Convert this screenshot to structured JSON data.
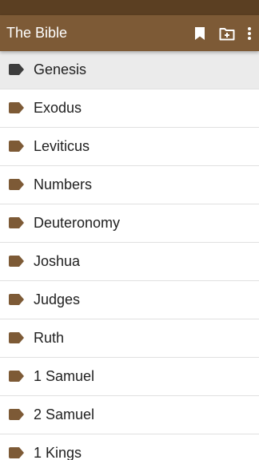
{
  "colors": {
    "status_bar": "#5b3f22",
    "app_bar": "#7d5a36",
    "tag_default": "#7d5a36",
    "tag_selected": "#3d3d3d",
    "selected_row": "#ebebeb"
  },
  "app_bar": {
    "title": "The Bible",
    "actions": [
      {
        "icon": "bookmark-icon"
      },
      {
        "icon": "add-note-icon"
      },
      {
        "icon": "more-vert-icon"
      }
    ]
  },
  "books": [
    {
      "label": "Genesis",
      "selected": true,
      "icon": "label-tag-icon"
    },
    {
      "label": "Exodus",
      "selected": false,
      "icon": "label-tag-icon"
    },
    {
      "label": "Leviticus",
      "selected": false,
      "icon": "label-tag-icon"
    },
    {
      "label": "Numbers",
      "selected": false,
      "icon": "label-tag-icon"
    },
    {
      "label": "Deuteronomy",
      "selected": false,
      "icon": "label-tag-icon"
    },
    {
      "label": "Joshua",
      "selected": false,
      "icon": "label-tag-icon"
    },
    {
      "label": "Judges",
      "selected": false,
      "icon": "label-tag-icon"
    },
    {
      "label": "Ruth",
      "selected": false,
      "icon": "label-tag-icon"
    },
    {
      "label": "1 Samuel",
      "selected": false,
      "icon": "label-tag-icon"
    },
    {
      "label": "2 Samuel",
      "selected": false,
      "icon": "label-tag-icon"
    },
    {
      "label": "1 Kings",
      "selected": false,
      "icon": "label-tag-icon"
    }
  ]
}
